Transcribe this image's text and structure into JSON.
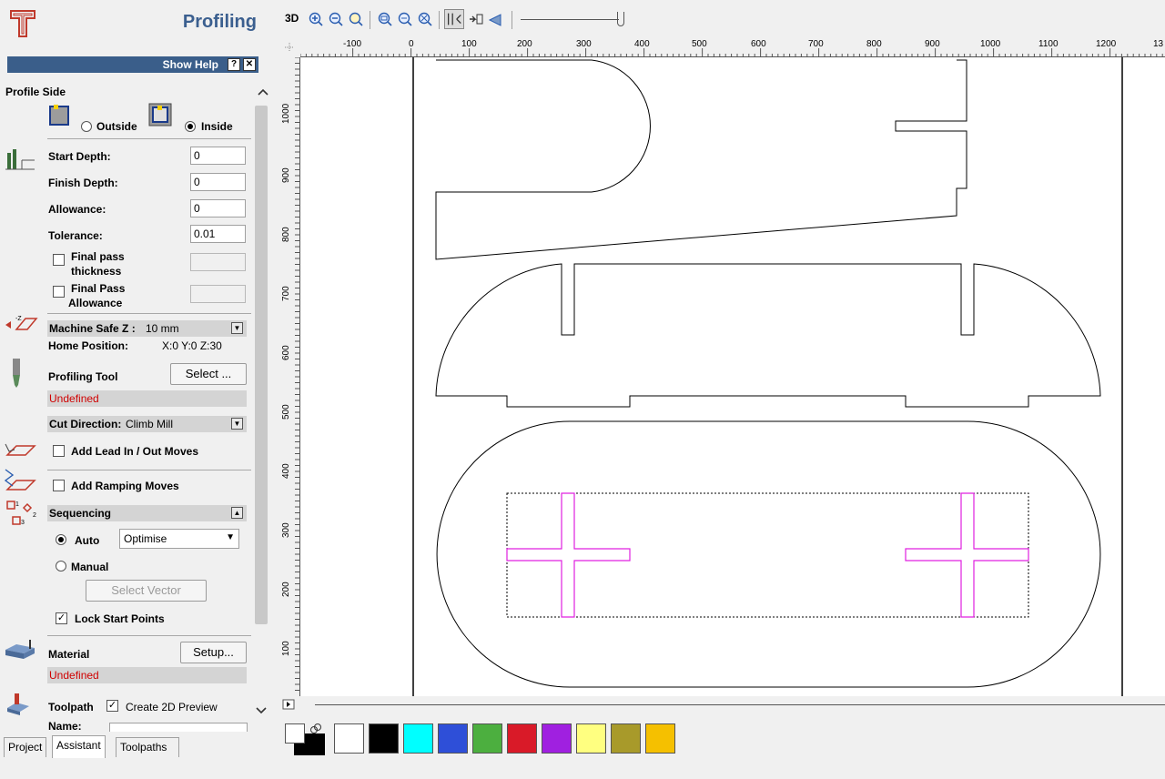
{
  "panel": {
    "title": "Profiling",
    "help_label": "Show Help",
    "help_btn": "?",
    "close_btn": "✕",
    "profile_side": {
      "heading": "Profile Side",
      "outside_label": "Outside",
      "inside_label": "Inside",
      "selected": "Inside"
    },
    "depths": {
      "start_label": "Start Depth:",
      "start_value": "0",
      "finish_label": "Finish Depth:",
      "finish_value": "0",
      "allowance_label": "Allowance:",
      "allowance_value": "0",
      "tolerance_label": "Tolerance:",
      "tolerance_value": "0.01",
      "final_pass_thickness_1": "Final pass",
      "final_pass_thickness_2": "thickness",
      "final_pass_allowance_1": "Final Pass",
      "final_pass_allowance_2": "Allowance"
    },
    "machine": {
      "safe_z_label": "Machine Safe Z :",
      "safe_z_value": "10 mm",
      "home_label": "Home Position:",
      "home_value": "X:0 Y:0 Z:30"
    },
    "tool": {
      "label": "Profiling Tool",
      "select_btn": "Select ...",
      "status": "Undefined"
    },
    "cut_direction": {
      "label": "Cut Direction:",
      "value": "Climb Mill"
    },
    "lead_in_label": "Add Lead In / Out Moves",
    "ramping_label": "Add Ramping Moves",
    "sequencing": {
      "label": "Sequencing",
      "auto_label": "Auto",
      "auto_option": "Optimise",
      "manual_label": "Manual",
      "select_vector_btn": "Select Vector",
      "lock_start_label": "Lock Start Points"
    },
    "material": {
      "label": "Material",
      "setup_btn": "Setup...",
      "status": "Undefined"
    },
    "toolpath": {
      "label": "Toolpath",
      "preview_label": "Create 2D Preview",
      "name_label": "Name:"
    },
    "tabs": [
      "Project",
      "Assistant",
      "Toolpaths"
    ]
  },
  "toolbar": {
    "mode_3d": "3D",
    "icons": [
      "zoom-in-icon",
      "zoom-out-icon",
      "zoom-fit-icon",
      "zoom-box-icon",
      "zoom-prev-icon",
      "zoom-all-icon",
      "snap-icon",
      "snap-grid-icon",
      "orientation-icon",
      "slider-track"
    ]
  },
  "ruler": {
    "h_labels": [
      "-100",
      "0",
      "100",
      "200",
      "300",
      "400",
      "500",
      "600",
      "700",
      "800",
      "900",
      "1000",
      "1100",
      "1200",
      "13"
    ],
    "v_labels": [
      "1000",
      "900",
      "800",
      "700",
      "600",
      "500",
      "400",
      "300",
      "200",
      "100"
    ]
  },
  "palette": {
    "colors": [
      "#ffffff",
      "#000000",
      "#00ffff",
      "#2e4fd8",
      "#4caf3f",
      "#d91a28",
      "#a020e0",
      "#ffff80",
      "#a89a2a",
      "#f5c000"
    ]
  }
}
